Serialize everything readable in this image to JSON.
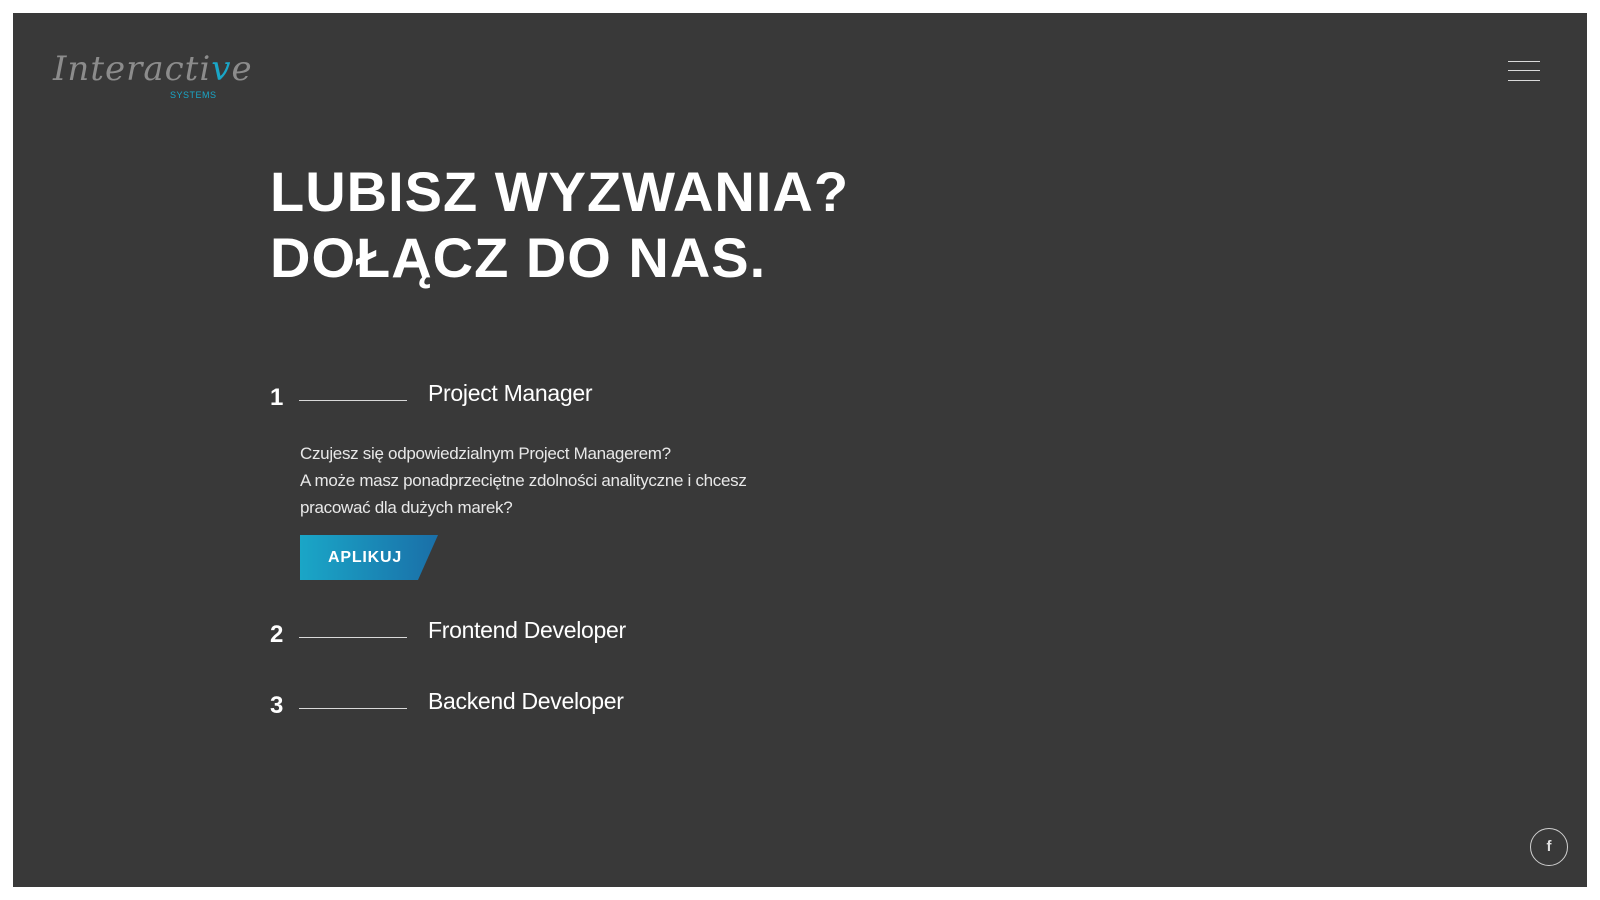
{
  "colors": {
    "background": "#393939",
    "accent": "#1aa6c7",
    "text": "#ffffff"
  },
  "logo": {
    "word_prefix": "Interacti",
    "word_accent": "v",
    "word_suffix": "e",
    "sub": "SYSTEMS"
  },
  "header": {
    "menu_icon": "hamburger-icon"
  },
  "headline": {
    "line1": "LUBISZ WYZWANIA?",
    "line2": "DOŁĄCZ DO NAS."
  },
  "jobs": [
    {
      "number": "1",
      "title": "Project Manager",
      "expanded": true,
      "description": [
        "Czujesz się odpowiedzialnym Project Managerem?",
        "A może masz ponadprzeciętne zdolności analityczne i chcesz",
        "pracować dla dużych marek?"
      ],
      "apply_label": "APLIKUJ"
    },
    {
      "number": "2",
      "title": "Frontend Developer",
      "expanded": false
    },
    {
      "number": "3",
      "title": "Backend Developer",
      "expanded": false
    }
  ],
  "social": {
    "facebook_glyph": "f",
    "icon": "facebook-icon"
  }
}
